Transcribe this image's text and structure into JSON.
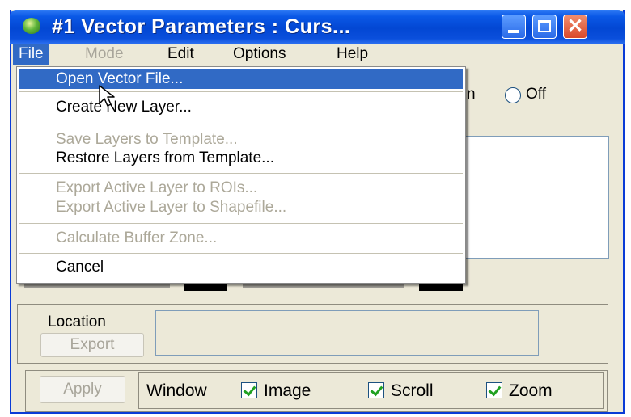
{
  "window": {
    "title": "#1 Vector Parameters : Curs..."
  },
  "menubar": {
    "items": [
      {
        "label": "File",
        "state": "active"
      },
      {
        "label": "Mode",
        "state": "disabled"
      },
      {
        "label": "Edit",
        "state": "normal"
      },
      {
        "label": "Options",
        "state": "normal"
      },
      {
        "label": "Help",
        "state": "normal"
      }
    ]
  },
  "file_menu": {
    "items": [
      {
        "label": "Open Vector File...",
        "state": "selected"
      },
      {
        "label": "Create New Layer...",
        "state": "enabled"
      },
      {
        "label": "Save Layers to Template...",
        "state": "disabled"
      },
      {
        "label": "Restore Layers from Template...",
        "state": "enabled"
      },
      {
        "label": "Export Active Layer to ROIs...",
        "state": "disabled"
      },
      {
        "label": "Export Active Layer to Shapefile...",
        "state": "disabled"
      },
      {
        "label": "Calculate Buffer Zone...",
        "state": "disabled"
      },
      {
        "label": "Cancel",
        "state": "enabled"
      }
    ]
  },
  "background": {
    "partial_text": "n",
    "off_radio_label": "Off"
  },
  "location": {
    "label": "Location",
    "export_label": "Export",
    "value": ""
  },
  "bottom": {
    "apply_label": "Apply",
    "window_label": "Window",
    "checkboxes": [
      {
        "label": "Image",
        "checked": true
      },
      {
        "label": "Scroll",
        "checked": true
      },
      {
        "label": "Zoom",
        "checked": true
      }
    ]
  },
  "colors": {
    "title_bar": "#0347d3",
    "selection": "#316ac5",
    "window_bg": "#ece9d8",
    "close_button": "#d9482a"
  }
}
